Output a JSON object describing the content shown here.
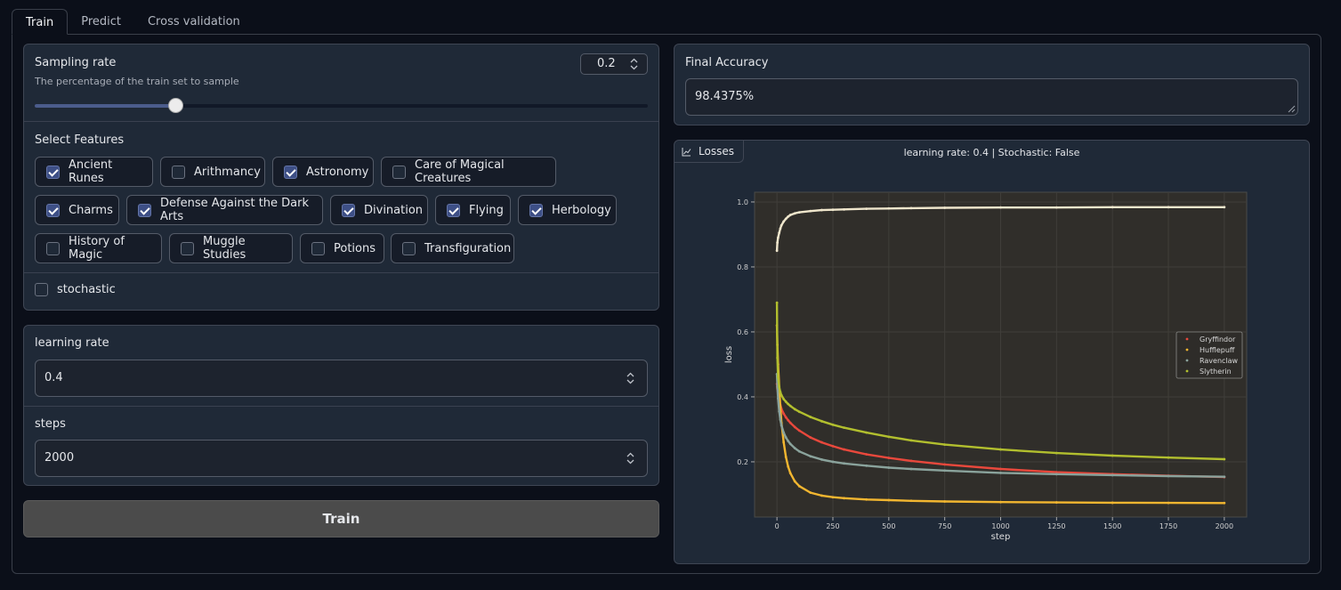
{
  "tabs": [
    {
      "label": "Train",
      "active": true
    },
    {
      "label": "Predict",
      "active": false
    },
    {
      "label": "Cross validation",
      "active": false
    }
  ],
  "sampling": {
    "label": "Sampling rate",
    "info": "The percentage of the train set to sample",
    "value": "0.2",
    "min": 0,
    "max": 1,
    "fraction": 0.229
  },
  "features": {
    "label": "Select Features",
    "items": [
      {
        "label": "Ancient Runes",
        "checked": true
      },
      {
        "label": "Arithmancy",
        "checked": false
      },
      {
        "label": "Astronomy",
        "checked": true
      },
      {
        "label": "Care of Magical Creatures",
        "checked": false
      },
      {
        "label": "Charms",
        "checked": true
      },
      {
        "label": "Defense Against the Dark Arts",
        "checked": true
      },
      {
        "label": "Divination",
        "checked": true
      },
      {
        "label": "Flying",
        "checked": true
      },
      {
        "label": "Herbology",
        "checked": true
      },
      {
        "label": "History of Magic",
        "checked": false
      },
      {
        "label": "Muggle Studies",
        "checked": false
      },
      {
        "label": "Potions",
        "checked": false
      },
      {
        "label": "Transfiguration",
        "checked": false
      }
    ]
  },
  "stochastic": {
    "label": "stochastic",
    "checked": false
  },
  "learning_rate": {
    "label": "learning rate",
    "value": "0.4"
  },
  "steps": {
    "label": "steps",
    "value": "2000"
  },
  "train_button": {
    "label": "Train"
  },
  "final_accuracy": {
    "label": "Final Accuracy",
    "value": "98.4375%"
  },
  "plot": {
    "label": "Losses",
    "icon": "chart-icon"
  },
  "colors": {
    "Gryffindor": "#e8483c",
    "Hufflepuff": "#f2b630",
    "Ravenclaw": "#8aa39c",
    "Slytherin": "#b2bf2e",
    "Accuracy": "#efe6cc"
  },
  "chart_data": {
    "type": "scatter",
    "title": "learning rate: 0.4 | Stochastic: False",
    "xlabel": "step",
    "ylabel": "loss",
    "xlim": [
      -100,
      2100
    ],
    "ylim": [
      0.03,
      1.03
    ],
    "xticks": [
      0,
      250,
      500,
      750,
      1000,
      1250,
      1500,
      1750,
      2000
    ],
    "yticks": [
      0.2,
      0.4,
      0.6,
      0.8,
      1.0
    ],
    "grid": true,
    "legend_position": "right",
    "x": [
      0,
      2,
      5,
      10,
      15,
      20,
      30,
      40,
      50,
      60,
      80,
      100,
      150,
      200,
      250,
      300,
      400,
      500,
      600,
      750,
      1000,
      1250,
      1500,
      1750,
      2000
    ],
    "series": [
      {
        "name": "Gryffindor",
        "in_legend": true,
        "values": [
          0.44,
          0.425,
          0.41,
          0.39,
          0.375,
          0.363,
          0.348,
          0.337,
          0.328,
          0.32,
          0.307,
          0.296,
          0.275,
          0.26,
          0.248,
          0.238,
          0.223,
          0.212,
          0.203,
          0.192,
          0.178,
          0.168,
          0.162,
          0.157,
          0.153
        ]
      },
      {
        "name": "Hufflepuff",
        "in_legend": true,
        "values": [
          0.62,
          0.56,
          0.5,
          0.43,
          0.37,
          0.32,
          0.26,
          0.215,
          0.185,
          0.165,
          0.14,
          0.125,
          0.105,
          0.096,
          0.091,
          0.088,
          0.084,
          0.082,
          0.08,
          0.078,
          0.076,
          0.075,
          0.074,
          0.0735,
          0.073
        ]
      },
      {
        "name": "Ravenclaw",
        "in_legend": true,
        "values": [
          0.47,
          0.43,
          0.395,
          0.355,
          0.33,
          0.312,
          0.29,
          0.275,
          0.264,
          0.255,
          0.242,
          0.232,
          0.217,
          0.207,
          0.2,
          0.195,
          0.188,
          0.182,
          0.178,
          0.173,
          0.166,
          0.162,
          0.159,
          0.156,
          0.154
        ]
      },
      {
        "name": "Slytherin",
        "in_legend": true,
        "values": [
          0.69,
          0.52,
          0.46,
          0.43,
          0.415,
          0.405,
          0.393,
          0.385,
          0.378,
          0.372,
          0.362,
          0.354,
          0.338,
          0.325,
          0.314,
          0.305,
          0.29,
          0.277,
          0.266,
          0.253,
          0.238,
          0.227,
          0.219,
          0.213,
          0.208
        ]
      },
      {
        "name": "Accuracy",
        "in_legend": false,
        "values": [
          0.85,
          0.875,
          0.89,
          0.905,
          0.918,
          0.928,
          0.94,
          0.948,
          0.955,
          0.96,
          0.965,
          0.968,
          0.972,
          0.975,
          0.976,
          0.977,
          0.979,
          0.98,
          0.981,
          0.982,
          0.983,
          0.983,
          0.984,
          0.984,
          0.984
        ]
      }
    ]
  }
}
